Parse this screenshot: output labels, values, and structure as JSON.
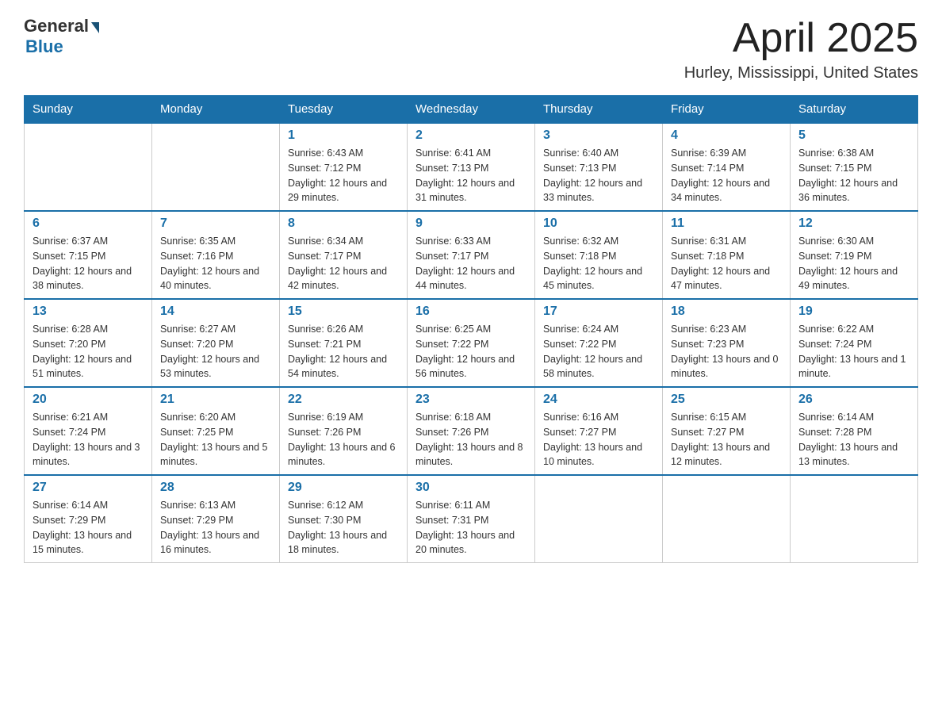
{
  "header": {
    "logo_general": "General",
    "logo_blue": "Blue",
    "title": "April 2025",
    "location": "Hurley, Mississippi, United States"
  },
  "weekdays": [
    "Sunday",
    "Monday",
    "Tuesday",
    "Wednesday",
    "Thursday",
    "Friday",
    "Saturday"
  ],
  "weeks": [
    [
      {
        "day": "",
        "sunrise": "",
        "sunset": "",
        "daylight": ""
      },
      {
        "day": "",
        "sunrise": "",
        "sunset": "",
        "daylight": ""
      },
      {
        "day": "1",
        "sunrise": "Sunrise: 6:43 AM",
        "sunset": "Sunset: 7:12 PM",
        "daylight": "Daylight: 12 hours and 29 minutes."
      },
      {
        "day": "2",
        "sunrise": "Sunrise: 6:41 AM",
        "sunset": "Sunset: 7:13 PM",
        "daylight": "Daylight: 12 hours and 31 minutes."
      },
      {
        "day": "3",
        "sunrise": "Sunrise: 6:40 AM",
        "sunset": "Sunset: 7:13 PM",
        "daylight": "Daylight: 12 hours and 33 minutes."
      },
      {
        "day": "4",
        "sunrise": "Sunrise: 6:39 AM",
        "sunset": "Sunset: 7:14 PM",
        "daylight": "Daylight: 12 hours and 34 minutes."
      },
      {
        "day": "5",
        "sunrise": "Sunrise: 6:38 AM",
        "sunset": "Sunset: 7:15 PM",
        "daylight": "Daylight: 12 hours and 36 minutes."
      }
    ],
    [
      {
        "day": "6",
        "sunrise": "Sunrise: 6:37 AM",
        "sunset": "Sunset: 7:15 PM",
        "daylight": "Daylight: 12 hours and 38 minutes."
      },
      {
        "day": "7",
        "sunrise": "Sunrise: 6:35 AM",
        "sunset": "Sunset: 7:16 PM",
        "daylight": "Daylight: 12 hours and 40 minutes."
      },
      {
        "day": "8",
        "sunrise": "Sunrise: 6:34 AM",
        "sunset": "Sunset: 7:17 PM",
        "daylight": "Daylight: 12 hours and 42 minutes."
      },
      {
        "day": "9",
        "sunrise": "Sunrise: 6:33 AM",
        "sunset": "Sunset: 7:17 PM",
        "daylight": "Daylight: 12 hours and 44 minutes."
      },
      {
        "day": "10",
        "sunrise": "Sunrise: 6:32 AM",
        "sunset": "Sunset: 7:18 PM",
        "daylight": "Daylight: 12 hours and 45 minutes."
      },
      {
        "day": "11",
        "sunrise": "Sunrise: 6:31 AM",
        "sunset": "Sunset: 7:18 PM",
        "daylight": "Daylight: 12 hours and 47 minutes."
      },
      {
        "day": "12",
        "sunrise": "Sunrise: 6:30 AM",
        "sunset": "Sunset: 7:19 PM",
        "daylight": "Daylight: 12 hours and 49 minutes."
      }
    ],
    [
      {
        "day": "13",
        "sunrise": "Sunrise: 6:28 AM",
        "sunset": "Sunset: 7:20 PM",
        "daylight": "Daylight: 12 hours and 51 minutes."
      },
      {
        "day": "14",
        "sunrise": "Sunrise: 6:27 AM",
        "sunset": "Sunset: 7:20 PM",
        "daylight": "Daylight: 12 hours and 53 minutes."
      },
      {
        "day": "15",
        "sunrise": "Sunrise: 6:26 AM",
        "sunset": "Sunset: 7:21 PM",
        "daylight": "Daylight: 12 hours and 54 minutes."
      },
      {
        "day": "16",
        "sunrise": "Sunrise: 6:25 AM",
        "sunset": "Sunset: 7:22 PM",
        "daylight": "Daylight: 12 hours and 56 minutes."
      },
      {
        "day": "17",
        "sunrise": "Sunrise: 6:24 AM",
        "sunset": "Sunset: 7:22 PM",
        "daylight": "Daylight: 12 hours and 58 minutes."
      },
      {
        "day": "18",
        "sunrise": "Sunrise: 6:23 AM",
        "sunset": "Sunset: 7:23 PM",
        "daylight": "Daylight: 13 hours and 0 minutes."
      },
      {
        "day": "19",
        "sunrise": "Sunrise: 6:22 AM",
        "sunset": "Sunset: 7:24 PM",
        "daylight": "Daylight: 13 hours and 1 minute."
      }
    ],
    [
      {
        "day": "20",
        "sunrise": "Sunrise: 6:21 AM",
        "sunset": "Sunset: 7:24 PM",
        "daylight": "Daylight: 13 hours and 3 minutes."
      },
      {
        "day": "21",
        "sunrise": "Sunrise: 6:20 AM",
        "sunset": "Sunset: 7:25 PM",
        "daylight": "Daylight: 13 hours and 5 minutes."
      },
      {
        "day": "22",
        "sunrise": "Sunrise: 6:19 AM",
        "sunset": "Sunset: 7:26 PM",
        "daylight": "Daylight: 13 hours and 6 minutes."
      },
      {
        "day": "23",
        "sunrise": "Sunrise: 6:18 AM",
        "sunset": "Sunset: 7:26 PM",
        "daylight": "Daylight: 13 hours and 8 minutes."
      },
      {
        "day": "24",
        "sunrise": "Sunrise: 6:16 AM",
        "sunset": "Sunset: 7:27 PM",
        "daylight": "Daylight: 13 hours and 10 minutes."
      },
      {
        "day": "25",
        "sunrise": "Sunrise: 6:15 AM",
        "sunset": "Sunset: 7:27 PM",
        "daylight": "Daylight: 13 hours and 12 minutes."
      },
      {
        "day": "26",
        "sunrise": "Sunrise: 6:14 AM",
        "sunset": "Sunset: 7:28 PM",
        "daylight": "Daylight: 13 hours and 13 minutes."
      }
    ],
    [
      {
        "day": "27",
        "sunrise": "Sunrise: 6:14 AM",
        "sunset": "Sunset: 7:29 PM",
        "daylight": "Daylight: 13 hours and 15 minutes."
      },
      {
        "day": "28",
        "sunrise": "Sunrise: 6:13 AM",
        "sunset": "Sunset: 7:29 PM",
        "daylight": "Daylight: 13 hours and 16 minutes."
      },
      {
        "day": "29",
        "sunrise": "Sunrise: 6:12 AM",
        "sunset": "Sunset: 7:30 PM",
        "daylight": "Daylight: 13 hours and 18 minutes."
      },
      {
        "day": "30",
        "sunrise": "Sunrise: 6:11 AM",
        "sunset": "Sunset: 7:31 PM",
        "daylight": "Daylight: 13 hours and 20 minutes."
      },
      {
        "day": "",
        "sunrise": "",
        "sunset": "",
        "daylight": ""
      },
      {
        "day": "",
        "sunrise": "",
        "sunset": "",
        "daylight": ""
      },
      {
        "day": "",
        "sunrise": "",
        "sunset": "",
        "daylight": ""
      }
    ]
  ]
}
